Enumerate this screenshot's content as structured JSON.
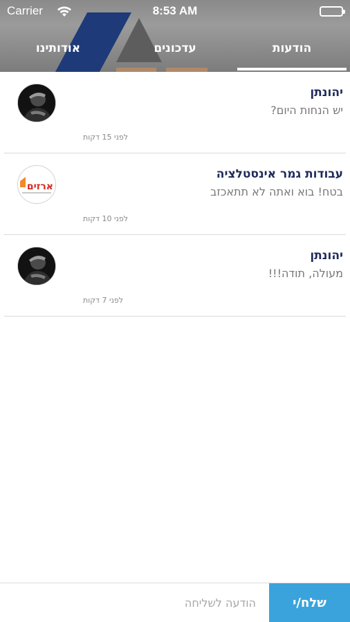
{
  "status_bar": {
    "carrier": "Carrier",
    "time": "8:53 AM",
    "wifi_icon": "wifi-icon",
    "battery_icon": "battery-icon",
    "battery_level": 1.0
  },
  "tabs": [
    {
      "label": "אודותינו",
      "selected": false
    },
    {
      "label": "עדכונים",
      "selected": false
    },
    {
      "label": "הודעות",
      "selected": true
    }
  ],
  "messages": [
    {
      "sender": "יהונתן",
      "preview": "יש הנחות היום?",
      "time": "לפני 15 דקות",
      "avatar": "person-photo-avatar"
    },
    {
      "sender": "עבודות גמר אינסטלציה",
      "preview": "בטח! בוא ואתה לא תתאכזב",
      "time": "לפני 10 דקות",
      "avatar": "company-logo-avatar"
    },
    {
      "sender": "יהונתן",
      "preview": "מעולה, תודה!!!",
      "time": "לפני 7 דקות",
      "avatar": "person-photo-avatar"
    }
  ],
  "company_logo_text": "ארזים",
  "composer": {
    "placeholder": "הודעה לשליחה",
    "value": "",
    "send_label": "שלח/י"
  },
  "colors": {
    "header_bg": "#8a8a8a",
    "logo_blue": "#1e3a78",
    "sender_text": "#1f2a5a",
    "send_button": "#3aa3dc",
    "logo_red": "#d6281f",
    "logo_orange": "#f08a2a"
  }
}
